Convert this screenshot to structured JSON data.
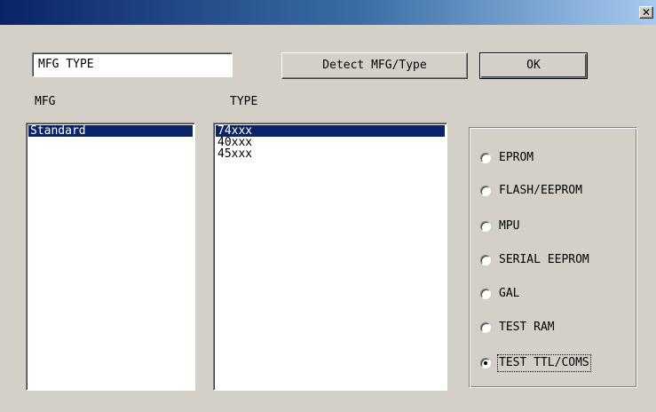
{
  "window": {
    "close_glyph": "✕"
  },
  "mfg_type_field": {
    "value": "MFG TYPE"
  },
  "buttons": {
    "detect_label": "Detect MFG/Type",
    "ok_label": "OK"
  },
  "labels": {
    "mfg": "MFG",
    "type": "TYPE"
  },
  "mfg_list": {
    "items": [
      "Standard"
    ],
    "selected_index": 0
  },
  "type_list": {
    "items": [
      "74xxx",
      "40xxx",
      "45xxx"
    ],
    "selected_index": 0
  },
  "device_options": {
    "items": [
      "EPROM",
      "FLASH/EEPROM",
      "MPU",
      "SERIAL EEPROM",
      "GAL",
      "TEST RAM",
      "TEST TTL/COMS"
    ],
    "selected_index": 6
  },
  "colors": {
    "selection": "#0a246a",
    "face": "#d4d0c8",
    "title_start": "#0a246a",
    "title_end": "#a6caf0"
  }
}
